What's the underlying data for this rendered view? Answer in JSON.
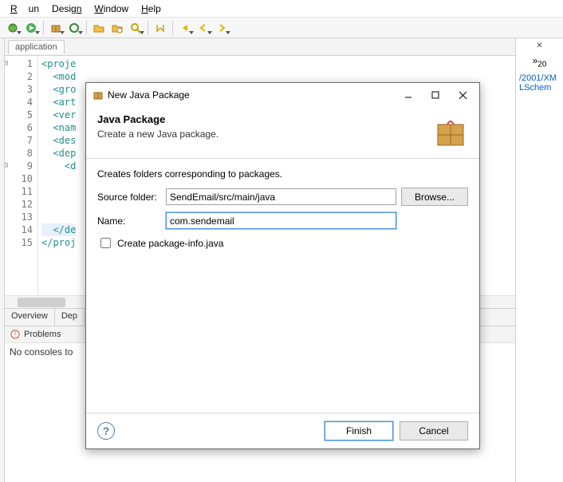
{
  "menu": {
    "items": [
      "Run",
      "Design",
      "Window",
      "Help"
    ]
  },
  "toolbar": {
    "icons": [
      "debug",
      "run",
      "run-ext",
      "new-pkg",
      "open",
      "open-folder",
      "open-type",
      "search",
      "key",
      "step",
      "back-menu",
      "back",
      "fwd",
      "fwd-menu"
    ]
  },
  "editor": {
    "tab_label": "application",
    "lines": [
      "<proje",
      "  <mod",
      "  <gro",
      "  <art",
      "  <ver",
      "  <nam",
      "  <des",
      "  <dep",
      "    <d",
      "",
      "",
      "",
      "",
      "  </de",
      "</proj"
    ],
    "bottom_tabs": [
      "Overview",
      "Dep"
    ]
  },
  "problems_view": {
    "title": "Problems",
    "console_text": "No consoles to"
  },
  "right_strip": {
    "link_fragment": "/2001/XMLSchem",
    "overflow_label": "»",
    "overflow_count": "20"
  },
  "dialog": {
    "window_title": "New Java Package",
    "heading": "Java Package",
    "subheading": "Create a new Java package.",
    "form": {
      "description": "Creates folders corresponding to packages.",
      "source_label": "Source folder:",
      "source_value": "SendEmail/src/main/java",
      "browse_label": "Browse...",
      "name_label": "Name:",
      "name_value": "com.sendemail",
      "checkbox_label": "Create package-info.java"
    },
    "buttons": {
      "finish": "Finish",
      "cancel": "Cancel"
    }
  }
}
